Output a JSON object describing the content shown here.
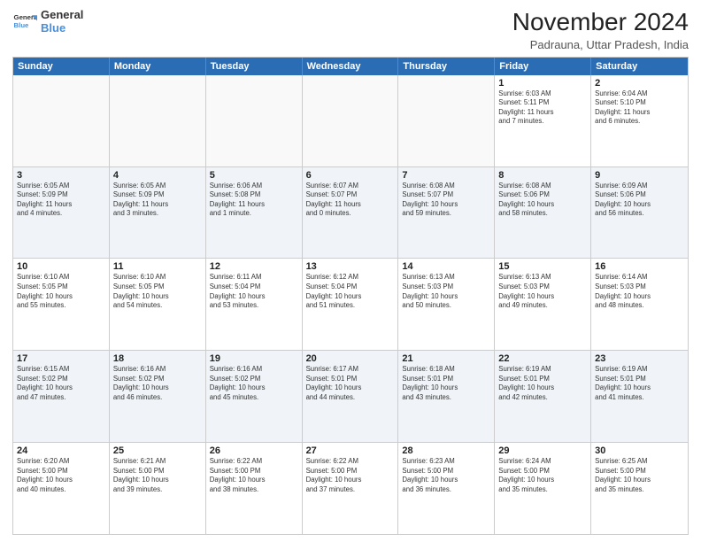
{
  "logo": {
    "line1": "General",
    "line2": "Blue"
  },
  "title": "November 2024",
  "subtitle": "Padrauna, Uttar Pradesh, India",
  "colors": {
    "header_bg": "#2a6db5",
    "alt_bg": "#f0f4f8"
  },
  "weekdays": [
    "Sunday",
    "Monday",
    "Tuesday",
    "Wednesday",
    "Thursday",
    "Friday",
    "Saturday"
  ],
  "weeks": [
    [
      {
        "day": "",
        "info": ""
      },
      {
        "day": "",
        "info": ""
      },
      {
        "day": "",
        "info": ""
      },
      {
        "day": "",
        "info": ""
      },
      {
        "day": "",
        "info": ""
      },
      {
        "day": "1",
        "info": "Sunrise: 6:03 AM\nSunset: 5:11 PM\nDaylight: 11 hours\nand 7 minutes."
      },
      {
        "day": "2",
        "info": "Sunrise: 6:04 AM\nSunset: 5:10 PM\nDaylight: 11 hours\nand 6 minutes."
      }
    ],
    [
      {
        "day": "3",
        "info": "Sunrise: 6:05 AM\nSunset: 5:09 PM\nDaylight: 11 hours\nand 4 minutes."
      },
      {
        "day": "4",
        "info": "Sunrise: 6:05 AM\nSunset: 5:09 PM\nDaylight: 11 hours\nand 3 minutes."
      },
      {
        "day": "5",
        "info": "Sunrise: 6:06 AM\nSunset: 5:08 PM\nDaylight: 11 hours\nand 1 minute."
      },
      {
        "day": "6",
        "info": "Sunrise: 6:07 AM\nSunset: 5:07 PM\nDaylight: 11 hours\nand 0 minutes."
      },
      {
        "day": "7",
        "info": "Sunrise: 6:08 AM\nSunset: 5:07 PM\nDaylight: 10 hours\nand 59 minutes."
      },
      {
        "day": "8",
        "info": "Sunrise: 6:08 AM\nSunset: 5:06 PM\nDaylight: 10 hours\nand 58 minutes."
      },
      {
        "day": "9",
        "info": "Sunrise: 6:09 AM\nSunset: 5:06 PM\nDaylight: 10 hours\nand 56 minutes."
      }
    ],
    [
      {
        "day": "10",
        "info": "Sunrise: 6:10 AM\nSunset: 5:05 PM\nDaylight: 10 hours\nand 55 minutes."
      },
      {
        "day": "11",
        "info": "Sunrise: 6:10 AM\nSunset: 5:05 PM\nDaylight: 10 hours\nand 54 minutes."
      },
      {
        "day": "12",
        "info": "Sunrise: 6:11 AM\nSunset: 5:04 PM\nDaylight: 10 hours\nand 53 minutes."
      },
      {
        "day": "13",
        "info": "Sunrise: 6:12 AM\nSunset: 5:04 PM\nDaylight: 10 hours\nand 51 minutes."
      },
      {
        "day": "14",
        "info": "Sunrise: 6:13 AM\nSunset: 5:03 PM\nDaylight: 10 hours\nand 50 minutes."
      },
      {
        "day": "15",
        "info": "Sunrise: 6:13 AM\nSunset: 5:03 PM\nDaylight: 10 hours\nand 49 minutes."
      },
      {
        "day": "16",
        "info": "Sunrise: 6:14 AM\nSunset: 5:03 PM\nDaylight: 10 hours\nand 48 minutes."
      }
    ],
    [
      {
        "day": "17",
        "info": "Sunrise: 6:15 AM\nSunset: 5:02 PM\nDaylight: 10 hours\nand 47 minutes."
      },
      {
        "day": "18",
        "info": "Sunrise: 6:16 AM\nSunset: 5:02 PM\nDaylight: 10 hours\nand 46 minutes."
      },
      {
        "day": "19",
        "info": "Sunrise: 6:16 AM\nSunset: 5:02 PM\nDaylight: 10 hours\nand 45 minutes."
      },
      {
        "day": "20",
        "info": "Sunrise: 6:17 AM\nSunset: 5:01 PM\nDaylight: 10 hours\nand 44 minutes."
      },
      {
        "day": "21",
        "info": "Sunrise: 6:18 AM\nSunset: 5:01 PM\nDaylight: 10 hours\nand 43 minutes."
      },
      {
        "day": "22",
        "info": "Sunrise: 6:19 AM\nSunset: 5:01 PM\nDaylight: 10 hours\nand 42 minutes."
      },
      {
        "day": "23",
        "info": "Sunrise: 6:19 AM\nSunset: 5:01 PM\nDaylight: 10 hours\nand 41 minutes."
      }
    ],
    [
      {
        "day": "24",
        "info": "Sunrise: 6:20 AM\nSunset: 5:00 PM\nDaylight: 10 hours\nand 40 minutes."
      },
      {
        "day": "25",
        "info": "Sunrise: 6:21 AM\nSunset: 5:00 PM\nDaylight: 10 hours\nand 39 minutes."
      },
      {
        "day": "26",
        "info": "Sunrise: 6:22 AM\nSunset: 5:00 PM\nDaylight: 10 hours\nand 38 minutes."
      },
      {
        "day": "27",
        "info": "Sunrise: 6:22 AM\nSunset: 5:00 PM\nDaylight: 10 hours\nand 37 minutes."
      },
      {
        "day": "28",
        "info": "Sunrise: 6:23 AM\nSunset: 5:00 PM\nDaylight: 10 hours\nand 36 minutes."
      },
      {
        "day": "29",
        "info": "Sunrise: 6:24 AM\nSunset: 5:00 PM\nDaylight: 10 hours\nand 35 minutes."
      },
      {
        "day": "30",
        "info": "Sunrise: 6:25 AM\nSunset: 5:00 PM\nDaylight: 10 hours\nand 35 minutes."
      }
    ]
  ]
}
